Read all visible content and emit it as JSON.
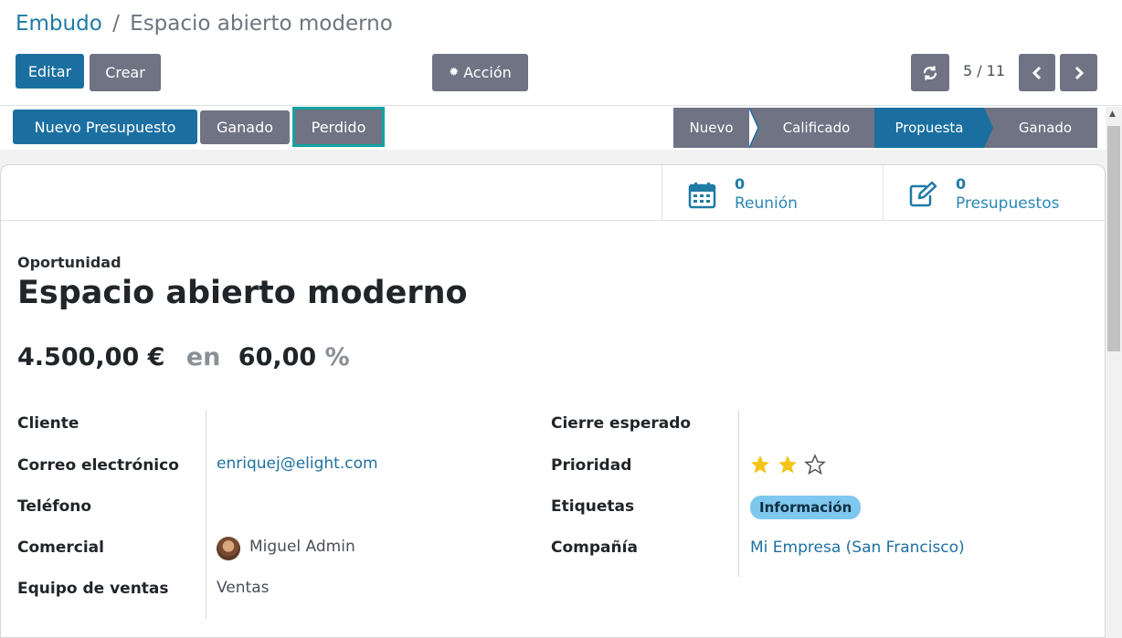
{
  "breadcrumb": {
    "parent": "Embudo",
    "separator": "/",
    "current": "Espacio abierto moderno"
  },
  "toolbar": {
    "edit_label": "Editar",
    "create_label": "Crear",
    "action_label": "Acción",
    "pager_text": "5 / 11"
  },
  "status_buttons": {
    "new_quote": "Nuevo Presupuesto",
    "won": "Ganado",
    "lost": "Perdido"
  },
  "stages": [
    {
      "label": "Nuevo",
      "active": false
    },
    {
      "label": "Calificado",
      "active": false
    },
    {
      "label": "Propuesta",
      "active": true
    },
    {
      "label": "Ganado",
      "active": false
    }
  ],
  "smart_buttons": [
    {
      "count": "0",
      "label": "Reunión",
      "icon": "calendar-icon"
    },
    {
      "count": "0",
      "label": "Presupuestos",
      "icon": "edit-icon"
    }
  ],
  "record": {
    "type_label": "Oportunidad",
    "title": "Espacio abierto moderno",
    "revenue": "4.500,00 €",
    "in_word": "en",
    "probability": "60,00",
    "percent": "%"
  },
  "fields_left": [
    {
      "label": "Cliente",
      "value": ""
    },
    {
      "label": "Correo electrónico",
      "value": "enriquej@elight.com"
    },
    {
      "label": "Teléfono",
      "value": ""
    },
    {
      "label": "Comercial",
      "value": "Miguel Admin"
    },
    {
      "label": "Equipo de ventas",
      "value": "Ventas"
    }
  ],
  "fields_right": [
    {
      "label": "Cierre esperado",
      "value": ""
    },
    {
      "label": "Prioridad",
      "value": ""
    },
    {
      "label": "Etiquetas",
      "value": "Información"
    },
    {
      "label": "Compañía",
      "value": "Mi Empresa (San Francisco)"
    }
  ],
  "priority": {
    "filled": 2,
    "total": 3
  },
  "colors": {
    "primary": "#1b6fa0",
    "secondary": "#6f7384",
    "link": "#1f7aa6",
    "tag": "#7ec7ef",
    "star": "#f3c316"
  }
}
